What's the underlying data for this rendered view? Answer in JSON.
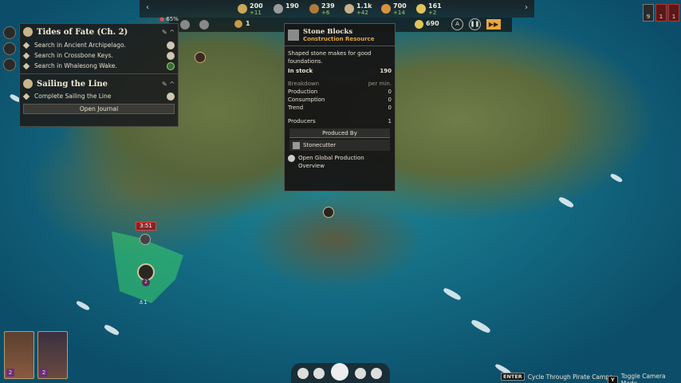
{
  "resources": [
    {
      "name": "food",
      "value": "200",
      "delta": "+11",
      "color": "#caa85a"
    },
    {
      "name": "stone",
      "value": "190",
      "delta": "",
      "color": "#9a9a9a"
    },
    {
      "name": "wood",
      "value": "239",
      "delta": "+6",
      "color": "#b07a3a"
    },
    {
      "name": "tools",
      "value": "1.1k",
      "delta": "+42",
      "color": "#c9b08a"
    },
    {
      "name": "rum",
      "value": "700",
      "delta": "+14",
      "color": "#d8913f"
    },
    {
      "name": "gold",
      "value": "161",
      "delta": "+2",
      "color": "#e0c45a"
    }
  ],
  "topbar2": {
    "count_left": "1",
    "gold": "690"
  },
  "left_widget": {
    "percent": "65%"
  },
  "right_top": {
    "a": "9",
    "b": "1",
    "c": "1"
  },
  "quests": {
    "tides": {
      "title": "Tides of Fate (Ch. 2)",
      "items": [
        "Search in Ancient Archipelago.",
        "Search in Crossbone Keys.",
        "Search in Whalesong Wake."
      ]
    },
    "sailing": {
      "title": "Sailing the Line",
      "items": [
        "Complete Sailing the Line"
      ]
    },
    "open_journal": "Open Journal"
  },
  "tooltip": {
    "title": "Stone Blocks",
    "subtitle": "Construction Resource",
    "description": "Shaped stone makes for good foundations.",
    "in_stock_label": "In stock",
    "in_stock": "190",
    "breakdown_label": "Breakdown",
    "per_min_label": "per min.",
    "production_label": "Production",
    "production": "0",
    "consumption_label": "Consumption",
    "consumption": "0",
    "trend_label": "Trend",
    "trend": "0",
    "producers_label": "Producers",
    "producers": "1",
    "produced_by_label": "Produced By",
    "producer_name": "Stonecutter",
    "global_overview": "Open Global Production Overview"
  },
  "map": {
    "timer": "3:51",
    "unit_count": "2",
    "ship_count": "1"
  },
  "portraits": [
    {
      "level": "2"
    },
    {
      "level": "2"
    }
  ],
  "hints": {
    "enter_key": "ENTER",
    "enter_label": "Cycle Through Pirate Camps",
    "y_key": "Y",
    "y_label": "Toggle Camera Mode"
  },
  "colors": {
    "accent": "#e8a83e",
    "green_zone": "#3bd26a",
    "timer_bg": "#8a2222"
  }
}
